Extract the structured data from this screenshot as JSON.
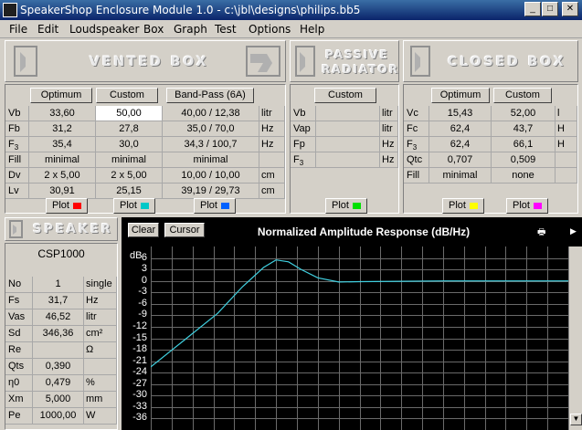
{
  "window": {
    "title": "SpeakerShop Enclosure Module 1.0 - c:\\jbl\\designs\\philips.bb5"
  },
  "menu": [
    "File",
    "Edit",
    "Loudspeaker",
    "Box",
    "Graph",
    "Test",
    "Options",
    "Help"
  ],
  "vented": {
    "header": "VENTED BOX",
    "buttons": [
      "Optimum",
      "Custom",
      "Band-Pass (6A)"
    ],
    "rows": [
      {
        "label": "Vb",
        "sub": "",
        "optimum": "33,60",
        "custom": "50,00",
        "bandpass": "40,00 / 12,38",
        "unit": "litr"
      },
      {
        "label": "Fb",
        "sub": "",
        "optimum": "31,2",
        "custom": "27,8",
        "bandpass": "35,0 / 70,0",
        "unit": "Hz"
      },
      {
        "label": "F",
        "sub": "3",
        "optimum": "35,4",
        "custom": "30,0",
        "bandpass": "34,3 / 100,7",
        "unit": "Hz"
      },
      {
        "label": "Fill",
        "sub": "",
        "optimum": "minimal",
        "custom": "minimal",
        "bandpass": "minimal",
        "unit": ""
      },
      {
        "label": "Dv",
        "sub": "",
        "optimum": "2 x 5,00",
        "custom": "2 x 5,00",
        "bandpass": "10,00 / 10,00",
        "unit": "cm"
      },
      {
        "label": "Lv",
        "sub": "",
        "optimum": "30,91",
        "custom": "25,15",
        "bandpass": "39,19 / 29,73",
        "unit": "cm"
      }
    ],
    "plot_label": "Plot",
    "colors": [
      "#ff0000",
      "#00c8c8",
      "#0060ff"
    ]
  },
  "passive": {
    "header_line1": "PASSIVE",
    "header_line2": "RADIATOR",
    "button": "Custom",
    "rows": [
      {
        "label": "Vb",
        "sub": "",
        "unit": "litr"
      },
      {
        "label": "Vap",
        "sub": "",
        "unit": "litr"
      },
      {
        "label": "Fp",
        "sub": "",
        "unit": "Hz"
      },
      {
        "label": "F",
        "sub": "3",
        "unit": "Hz"
      }
    ],
    "plot_label": "Plot",
    "color": "#00e000"
  },
  "closed": {
    "header": "CLOSED BOX",
    "buttons": [
      "Optimum",
      "Custom"
    ],
    "rows": [
      {
        "label": "Vc",
        "sub": "",
        "optimum": "15,43",
        "custom": "52,00",
        "unit": "l"
      },
      {
        "label": "Fc",
        "sub": "",
        "optimum": "62,4",
        "custom": "43,7",
        "unit": "H"
      },
      {
        "label": "F",
        "sub": "3",
        "optimum": "62,4",
        "custom": "66,1",
        "unit": "H"
      },
      {
        "label": "Qtc",
        "sub": "",
        "optimum": "0,707",
        "custom": "0,509",
        "unit": ""
      },
      {
        "label": "Fill",
        "sub": "",
        "optimum": "minimal",
        "custom": "none",
        "unit": ""
      }
    ],
    "plot_label": "Plot",
    "colors": [
      "#ffff00",
      "#ff00ff"
    ]
  },
  "speaker": {
    "header": "SPEAKER",
    "model": "CSP1000",
    "rows": [
      {
        "label": "No",
        "value": "1",
        "unit": "single"
      },
      {
        "label": "Fs",
        "value": "31,7",
        "unit": "Hz"
      },
      {
        "label": "Vas",
        "value": "46,52",
        "unit": "litr"
      },
      {
        "label": "Sd",
        "value": "346,36",
        "unit": "cm²"
      },
      {
        "label": "Re",
        "value": "",
        "unit": "Ω"
      },
      {
        "label": "Qts",
        "value": "0,390",
        "unit": ""
      },
      {
        "label": "η0",
        "value": "0,479",
        "unit": "%"
      },
      {
        "label": "Xm",
        "value": "5,000",
        "unit": "mm"
      },
      {
        "label": "Pe",
        "value": "1000,00",
        "unit": "W"
      }
    ]
  },
  "graph": {
    "clear_label": "Clear",
    "cursor_label": "Cursor",
    "title": "Normalized Amplitude Response (dB/Hz)",
    "y_unit": "dB",
    "y_ticks": [
      "6",
      "3",
      "0",
      "-3",
      "-6",
      "-9",
      "-12",
      "-15",
      "-18",
      "-21",
      "-24",
      "-27",
      "-30",
      "-33",
      "-36"
    ]
  },
  "chart_data": {
    "type": "line",
    "title": "Normalized Amplitude Response (dB/Hz)",
    "ylabel": "dB",
    "ylim": [
      -39,
      9
    ],
    "y_ticks": [
      6,
      3,
      0,
      -3,
      -6,
      -9,
      -12,
      -15,
      -18,
      -21,
      -24,
      -27,
      -30,
      -33,
      -36
    ],
    "grid": true,
    "series": [
      {
        "color": "#40d0e0",
        "x": [
          0,
          0.08,
          0.16,
          0.22,
          0.27,
          0.3,
          0.33,
          0.36,
          0.4,
          0.45,
          0.5,
          0.6,
          0.7,
          0.8,
          0.9,
          1.0
        ],
        "values": [
          -22.5,
          -15.5,
          -8.5,
          -1.5,
          3.5,
          5.5,
          5.0,
          3.0,
          0.8,
          -0.3,
          -0.2,
          -0.1,
          0,
          0,
          0,
          0
        ]
      }
    ]
  }
}
